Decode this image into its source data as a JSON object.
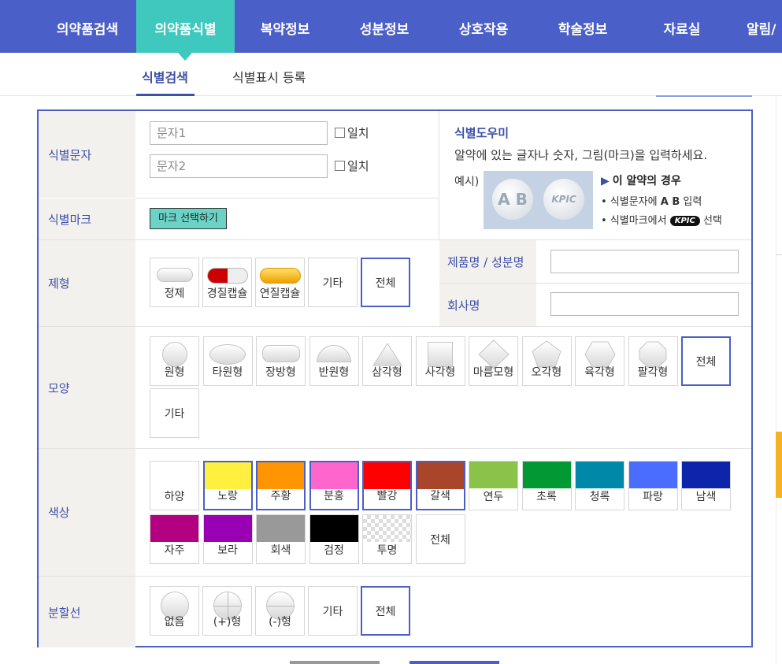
{
  "nav": {
    "items": [
      "의약품검색",
      "의약품식별",
      "복약정보",
      "성분정보",
      "상호작용",
      "학술정보",
      "자료실",
      "알림/"
    ],
    "active_index": 1
  },
  "subnav": {
    "items": [
      "식별검색",
      "식별표시 등록"
    ],
    "active_index": 0
  },
  "form": {
    "labels": {
      "text": "식별문자",
      "mark": "식별마크",
      "form": "제형",
      "shape": "모양",
      "color": "색상",
      "line": "분할선"
    },
    "text_inputs": [
      {
        "placeholder": "문자1",
        "check_label": "일치"
      },
      {
        "placeholder": "문자2",
        "check_label": "일치"
      }
    ],
    "mark_button": "마크 선택하기",
    "help": {
      "title": "식별도우미",
      "desc": "알약에 있는 글자나 숫자, 그림(마크)을 입력하세요.",
      "example_label": "예시)",
      "pill_text": [
        "A B",
        "KPIC"
      ],
      "case_title": "이 알약의 경우",
      "lines": [
        {
          "prefix": "• 식별문자에 ",
          "strong": "A B",
          "suffix": " 입력"
        },
        {
          "prefix": "• 식별마크에서 ",
          "badge": "KPIC",
          "suffix": " 선택"
        }
      ]
    },
    "product_label": "제품명 / 성분명",
    "company_label": "회사명",
    "forms": [
      {
        "label": "정제",
        "icon": "tablet-icon"
      },
      {
        "label": "경질캡슐",
        "icon": "hard-capsule-icon"
      },
      {
        "label": "연질캡슐",
        "icon": "soft-capsule-icon"
      },
      {
        "label": "기타",
        "icon": ""
      },
      {
        "label": "전체",
        "icon": "",
        "selected": true
      }
    ],
    "shapes": [
      {
        "label": "원형",
        "icon": "circle-icon"
      },
      {
        "label": "타원형",
        "icon": "oval-icon"
      },
      {
        "label": "장방형",
        "icon": "oblong-icon"
      },
      {
        "label": "반원형",
        "icon": "semicircle-icon"
      },
      {
        "label": "삼각형",
        "icon": "triangle-icon"
      },
      {
        "label": "사각형",
        "icon": "square-icon"
      },
      {
        "label": "마름모형",
        "icon": "diamond-icon"
      },
      {
        "label": "오각형",
        "icon": "pentagon-icon"
      },
      {
        "label": "육각형",
        "icon": "hexagon-icon"
      },
      {
        "label": "팔각형",
        "icon": "octagon-icon"
      },
      {
        "label": "전체",
        "icon": "",
        "selected": true
      },
      {
        "label": "기타",
        "icon": ""
      }
    ],
    "colors": [
      {
        "label": "하양",
        "hex": "#ffffff"
      },
      {
        "label": "노랑",
        "hex": "#fff040",
        "selected": true
      },
      {
        "label": "주황",
        "hex": "#ff9500",
        "selected": true
      },
      {
        "label": "분홍",
        "hex": "#ff66cc",
        "selected": true
      },
      {
        "label": "빨강",
        "hex": "#ff0000",
        "selected": true
      },
      {
        "label": "갈색",
        "hex": "#a8452a",
        "selected": true
      },
      {
        "label": "연두",
        "hex": "#8bc34a"
      },
      {
        "label": "초록",
        "hex": "#009933"
      },
      {
        "label": "청록",
        "hex": "#0088a8"
      },
      {
        "label": "파랑",
        "hex": "#4a6cff"
      },
      {
        "label": "남색",
        "hex": "#0d25aa"
      },
      {
        "label": "자주",
        "hex": "#b30080"
      },
      {
        "label": "보라",
        "hex": "#9900b3"
      },
      {
        "label": "회색",
        "hex": "#999999"
      },
      {
        "label": "검정",
        "hex": "#000000"
      },
      {
        "label": "투명",
        "hex": "transparent"
      },
      {
        "label": "전체",
        "hex": ""
      }
    ],
    "lines": [
      {
        "label": "없음",
        "icon": "no-line-icon"
      },
      {
        "label": "(+)형",
        "icon": "plus-line-icon"
      },
      {
        "label": "(-)형",
        "icon": "minus-line-icon"
      },
      {
        "label": "기타",
        "icon": ""
      },
      {
        "label": "전체",
        "icon": "",
        "selected": true
      }
    ]
  },
  "colors": {
    "brand": "#4a5fc8",
    "accent": "#3fc8bd",
    "label_text": "#3d4fa8"
  }
}
